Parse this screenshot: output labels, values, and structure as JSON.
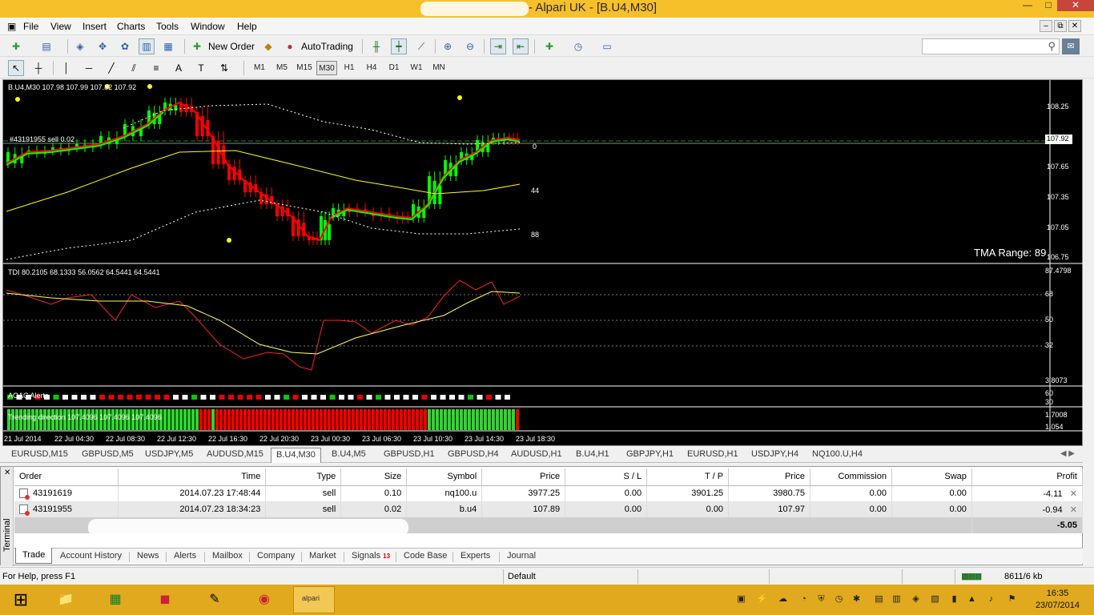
{
  "window": {
    "title": "- Alpari UK - [B.U4,M30]",
    "min_glyph": "—",
    "max_glyph": "□",
    "close_glyph": "✕"
  },
  "menu": {
    "items": [
      "File",
      "View",
      "Insert",
      "Charts",
      "Tools",
      "Window",
      "Help"
    ],
    "mdi": [
      "–",
      "⧉",
      "✕"
    ]
  },
  "toolbar": {
    "new_order": "New Order",
    "autotrading": "AutoTrading",
    "timeframes": [
      "M1",
      "M5",
      "M15",
      "M30",
      "H1",
      "H4",
      "D1",
      "W1",
      "MN"
    ],
    "active_timeframe": "M30",
    "search_placeholder": ""
  },
  "chart": {
    "symbol_label": "B.U4,M30  107.98 107.99 107.82 107.92",
    "order_label": "#43191955 sell 0.02",
    "band_labels": [
      "0",
      "44",
      "88"
    ],
    "tma_range": "TMA Range: 89",
    "price_axis": [
      "108.25",
      "107.65",
      "107.35",
      "107.05",
      "106.75"
    ],
    "current_price": "107.92",
    "tdi_label": "TDI 80.2105 68.1333 56.0562 64.5441 64.5441",
    "tdi_axis": [
      "87.4798",
      "68",
      "50",
      "32",
      "3.8073"
    ],
    "aoac_label": "AOAC Alerts",
    "aoac_axis": [
      "60",
      "30"
    ],
    "trend_label": "Trending direction 107.4096 107.4096 107.4096",
    "trend_axis": [
      "1.7008",
      "1.054"
    ],
    "time_axis": [
      "21 Jul 2014",
      "22 Jul 04:30",
      "22 Jul 08:30",
      "22 Jul 12:30",
      "22 Jul 16:30",
      "22 Jul 20:30",
      "23 Jul 00:30",
      "23 Jul 06:30",
      "23 Jul 10:30",
      "23 Jul 14:30",
      "23 Jul 18:30"
    ],
    "colors": {
      "background": "#000000",
      "bull_candle": "#00ff00",
      "bear_candle": "#ff0000",
      "ma_fast": "#00ff00",
      "ma_slow": "#ffff00",
      "tma_band": "#ffffff"
    }
  },
  "chart_tabs": [
    "EURUSD,M15",
    "GBPUSD,M5",
    "USDJPY,M5",
    "AUDUSD,M15",
    "B.U4,M30",
    "B.U4,M5",
    "GBPUSD,H1",
    "GBPUSD,H4",
    "AUDUSD,H1",
    "B.U4,H1",
    "GBPJPY,H1",
    "EURUSD,H1",
    "USDJPY,H4",
    "NQ100.U,H4"
  ],
  "active_chart_tab": "B.U4,M30",
  "terminal": {
    "side_label": "Terminal",
    "columns": [
      "Order",
      "Time",
      "Type",
      "Size",
      "Symbol",
      "Price",
      "S / L",
      "T / P",
      "Price",
      "Commission",
      "Swap",
      "Profit"
    ],
    "rows": [
      {
        "order": "43191619",
        "time": "2014.07.23 17:48:44",
        "type": "sell",
        "size": "0.10",
        "symbol": "nq100.u",
        "price": "3977.25",
        "sl": "0.00",
        "tp": "3901.25",
        "cur_price": "3980.75",
        "commission": "0.00",
        "swap": "0.00",
        "profit": "-4.11"
      },
      {
        "order": "43191955",
        "time": "2014.07.23 18:34:23",
        "type": "sell",
        "size": "0.02",
        "symbol": "b.u4",
        "price": "107.89",
        "sl": "0.00",
        "tp": "0.00",
        "cur_price": "107.97",
        "commission": "0.00",
        "swap": "0.00",
        "profit": "-0.94"
      }
    ],
    "balance_profit": "-5.05",
    "tabs": [
      "Trade",
      "Account History",
      "News",
      "Alerts",
      "Mailbox",
      "Company",
      "Market",
      "Signals",
      "Code Base",
      "Experts",
      "Journal"
    ],
    "signals_badge": "13",
    "active_tab": "Trade"
  },
  "status": {
    "help": "For Help, press F1",
    "profile": "Default",
    "traffic": "8611/6 kb"
  },
  "taskbar": {
    "time": "16:35",
    "date": "23/07/2014",
    "alpari_label": "alpari"
  }
}
